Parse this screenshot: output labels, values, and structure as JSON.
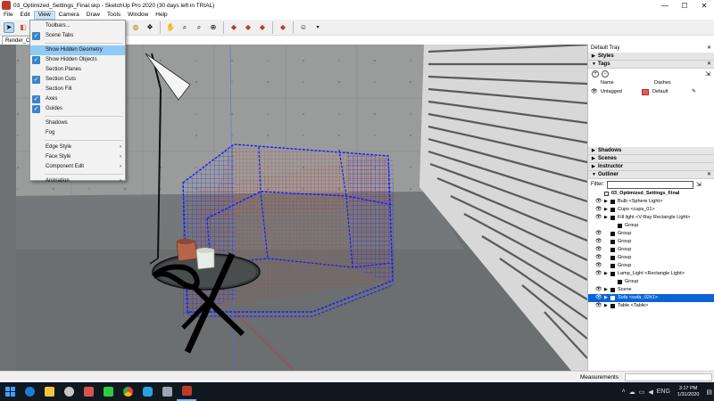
{
  "window": {
    "title": "03_Optimized_Settings_Final.skp - SketchUp Pro 2020 (30 days left in TRIAL)",
    "minimize": "—",
    "maximize": "☐",
    "close": "✕"
  },
  "menubar": [
    "File",
    "Edit",
    "View",
    "Camera",
    "Draw",
    "Tools",
    "Window",
    "Help"
  ],
  "scene_tab": "Render_Cam",
  "view_menu": {
    "items": [
      {
        "label": "Toolbars...",
        "checked": false,
        "submenu": false
      },
      {
        "label": "Scene Tabs",
        "checked": true,
        "submenu": false
      },
      {
        "label": "Show Hidden Geometry",
        "checked": false,
        "submenu": false,
        "highlighted": true
      },
      {
        "label": "Show Hidden Objects",
        "checked": true,
        "submenu": false
      },
      {
        "label": "Section Planes",
        "checked": false,
        "submenu": false
      },
      {
        "label": "Section Cuts",
        "checked": true,
        "submenu": false
      },
      {
        "label": "Section Fill",
        "checked": false,
        "submenu": false
      },
      {
        "label": "Axes",
        "checked": true,
        "submenu": false
      },
      {
        "label": "Guides",
        "checked": true,
        "submenu": false
      },
      {
        "label": "Shadows",
        "checked": false,
        "submenu": false
      },
      {
        "label": "Fog",
        "checked": false,
        "submenu": false
      },
      {
        "label": "Edge Style",
        "checked": false,
        "submenu": true
      },
      {
        "label": "Face Style",
        "checked": false,
        "submenu": true
      },
      {
        "label": "Component Edit",
        "checked": false,
        "submenu": true
      },
      {
        "label": "Animation",
        "checked": false,
        "submenu": true
      }
    ]
  },
  "tray": {
    "title": "Default Tray",
    "close": "✕",
    "styles_label": "Styles",
    "tags": {
      "title": "Tags",
      "col_name": "Name",
      "col_dashes": "Dashes",
      "row_name": "Untagged",
      "row_dashes": "Default",
      "swatch_color": "#e85b5b"
    },
    "shadows": "Shadows",
    "scenes": "Scenes",
    "instructor": "Instructor",
    "outliner": {
      "title": "Outliner",
      "filter_label": "Filter:",
      "root": "03_Optimized_Settings_Final",
      "rows": [
        {
          "label": "Bulb <Sphere Light>",
          "indent": 0,
          "eye": true,
          "expand": true
        },
        {
          "label": "Cups <cups_01>",
          "indent": 0,
          "eye": true,
          "expand": true
        },
        {
          "label": "Fill light <V-Ray Rectangle Light>",
          "indent": 0,
          "eye": true,
          "expand": true
        },
        {
          "label": "Group",
          "indent": 1,
          "eye": false,
          "expand": false
        },
        {
          "label": "Group",
          "indent": 0,
          "eye": true,
          "expand": false
        },
        {
          "label": "Group",
          "indent": 0,
          "eye": true,
          "expand": false
        },
        {
          "label": "Group",
          "indent": 0,
          "eye": true,
          "expand": false
        },
        {
          "label": "Group",
          "indent": 0,
          "eye": true,
          "expand": false
        },
        {
          "label": "Group",
          "indent": 0,
          "eye": true,
          "expand": false
        },
        {
          "label": "Lamp_Light <Rectangle Light>",
          "indent": 0,
          "eye": true,
          "expand": true
        },
        {
          "label": "Group",
          "indent": 1,
          "eye": false,
          "expand": false
        },
        {
          "label": "Scene",
          "indent": 0,
          "eye": true,
          "expand": true
        },
        {
          "label": "Sofa <sofa_02#1>",
          "indent": 0,
          "eye": true,
          "expand": true,
          "selected": true
        },
        {
          "label": "Table <Table>",
          "indent": 0,
          "eye": true,
          "expand": true
        }
      ]
    }
  },
  "statusbar": {
    "measurements": "Measurements"
  },
  "taskbar": {
    "time": "3:17 PM",
    "date": "1/31/2020",
    "lang": "ENG"
  }
}
